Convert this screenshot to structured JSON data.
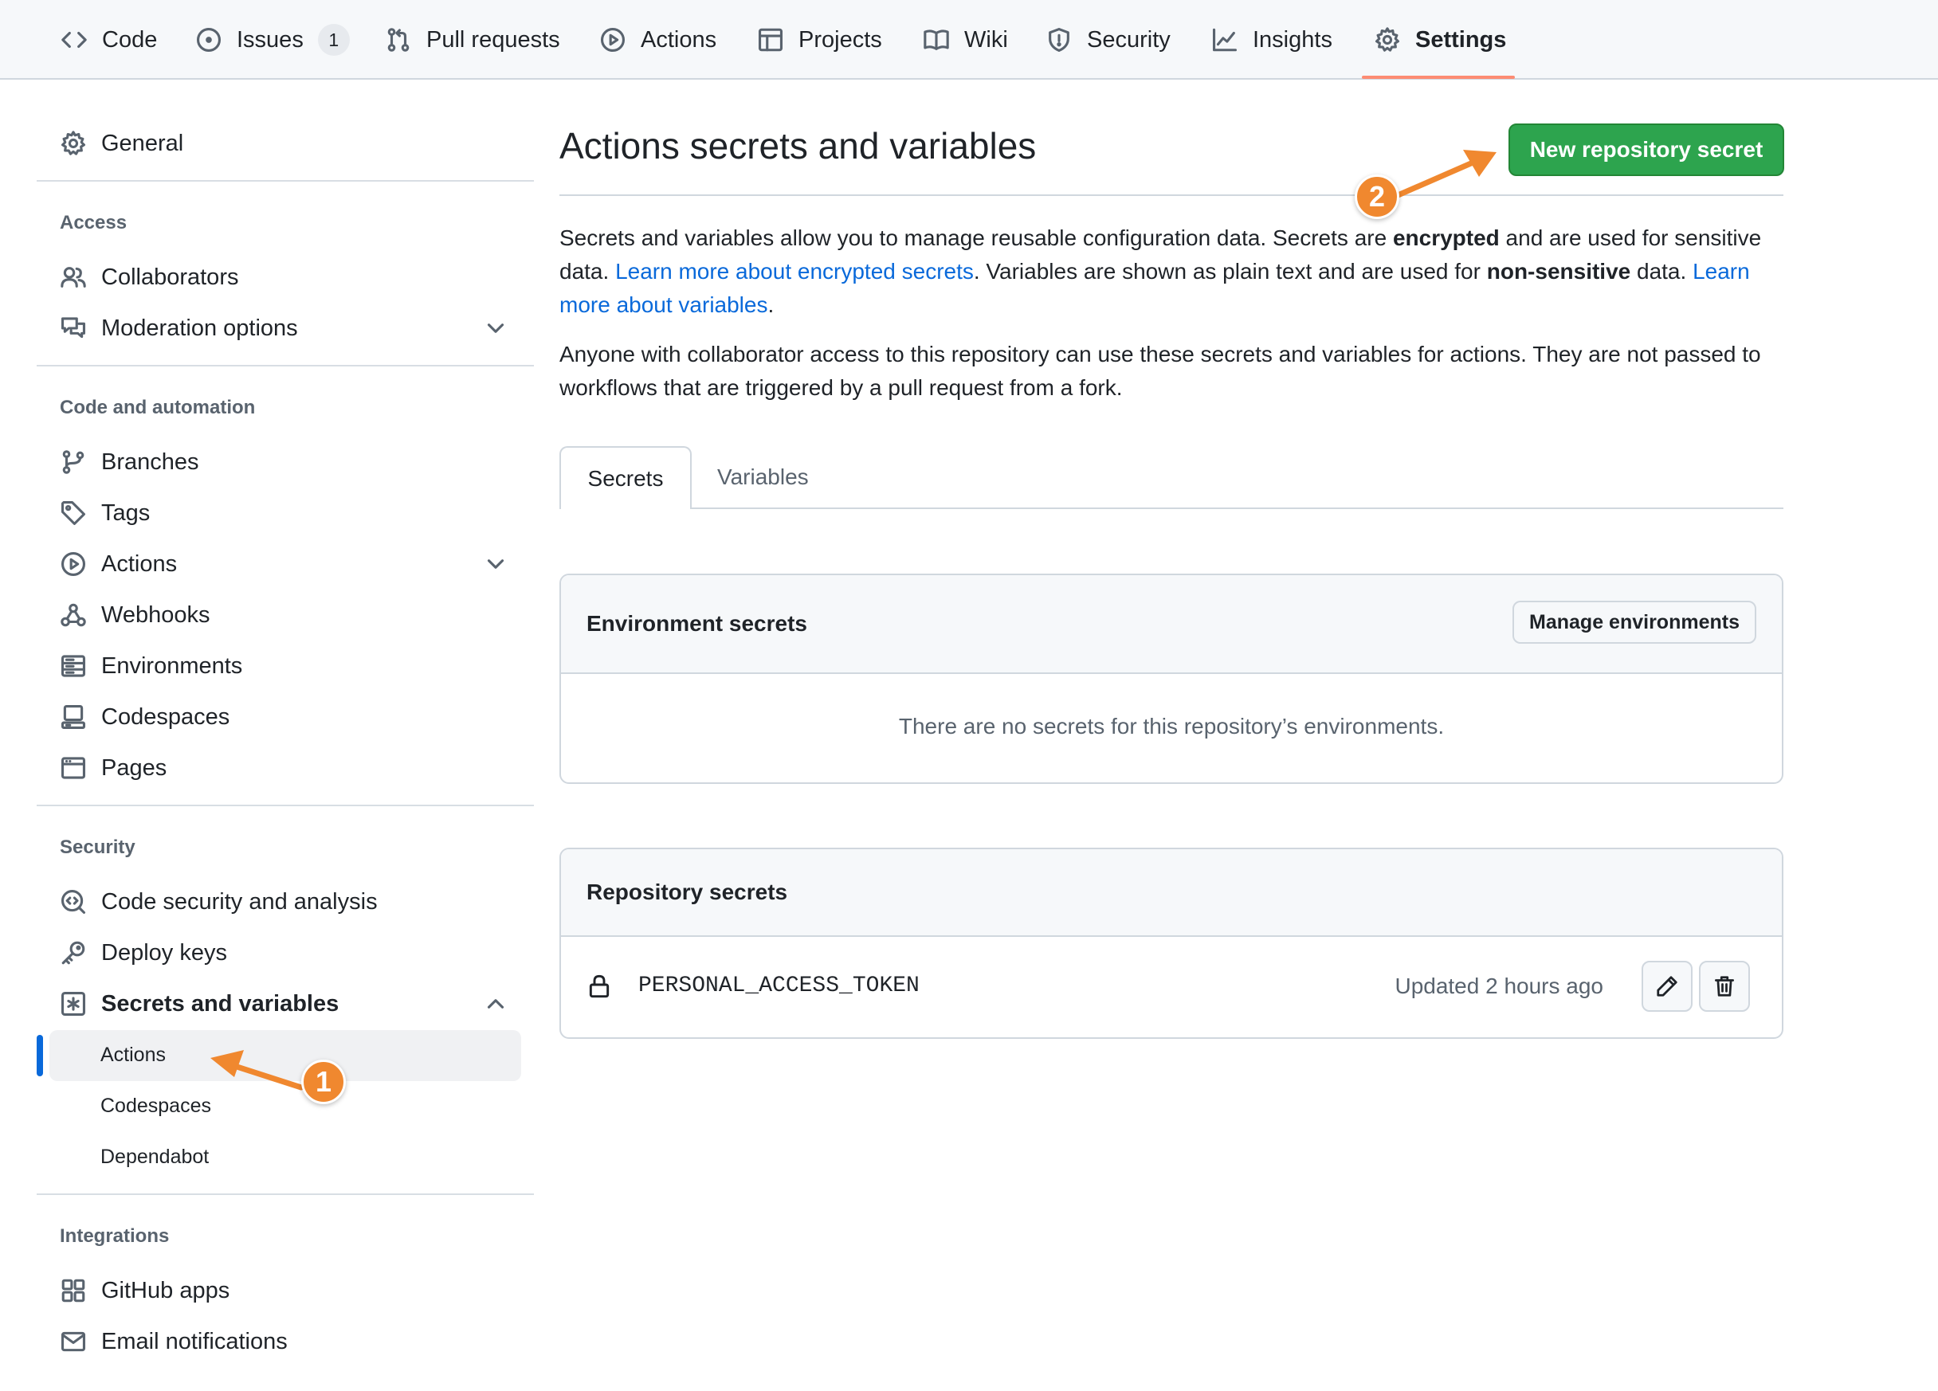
{
  "repo_nav": {
    "tabs": [
      {
        "label": "Code",
        "icon": "code-icon"
      },
      {
        "label": "Issues",
        "icon": "issue-opened-icon",
        "count": "1"
      },
      {
        "label": "Pull requests",
        "icon": "git-pull-request-icon"
      },
      {
        "label": "Actions",
        "icon": "play-icon"
      },
      {
        "label": "Projects",
        "icon": "table-icon"
      },
      {
        "label": "Wiki",
        "icon": "book-icon"
      },
      {
        "label": "Security",
        "icon": "shield-icon"
      },
      {
        "label": "Insights",
        "icon": "graph-icon"
      },
      {
        "label": "Settings",
        "icon": "gear-icon",
        "selected": true
      }
    ]
  },
  "sidebar": {
    "general": "General",
    "access_heading": "Access",
    "collaborators": "Collaborators",
    "moderation": "Moderation options",
    "code_heading": "Code and automation",
    "branches": "Branches",
    "tags": "Tags",
    "actions": "Actions",
    "webhooks": "Webhooks",
    "environments": "Environments",
    "codespaces": "Codespaces",
    "pages": "Pages",
    "security_heading": "Security",
    "code_security": "Code security and analysis",
    "deploy_keys": "Deploy keys",
    "secrets_vars": "Secrets and variables",
    "secrets_sub": [
      {
        "label": "Actions",
        "active": true
      },
      {
        "label": "Codespaces"
      },
      {
        "label": "Dependabot"
      }
    ],
    "integrations_heading": "Integrations",
    "github_apps": "GitHub apps",
    "email_notifications": "Email notifications"
  },
  "main": {
    "title": "Actions secrets and variables",
    "new_secret_button": "New repository secret",
    "intro": {
      "p1_a": "Secrets and variables allow you to manage reusable configuration data. Secrets are ",
      "p1_b": "encrypted",
      "p1_c": " and are used for sensitive data. ",
      "p1_link1": "Learn more about encrypted secrets",
      "p1_d": ". Variables are shown as plain text and are used for ",
      "p1_e": "non-sensitive",
      "p1_f": " data. ",
      "p1_link2": "Learn more about variables",
      "p1_g": ".",
      "p2": "Anyone with collaborator access to this repository can use these secrets and variables for actions. They are not passed to workflows that are triggered by a pull request from a fork."
    },
    "tabs": {
      "secrets": "Secrets",
      "variables": "Variables"
    },
    "env_secrets": {
      "title": "Environment secrets",
      "manage_button": "Manage environments",
      "empty": "There are no secrets for this repository’s environments."
    },
    "repo_secrets": {
      "title": "Repository secrets",
      "items": [
        {
          "name": "PERSONAL_ACCESS_TOKEN",
          "updated": "Updated 2 hours ago"
        }
      ]
    }
  },
  "annotations": {
    "callout_1": "1",
    "callout_2": "2",
    "color": "#f0882f"
  },
  "colors": {
    "accent_green": "#2da44e",
    "link_blue": "#0969da",
    "tab_underline": "#fd8c73"
  }
}
